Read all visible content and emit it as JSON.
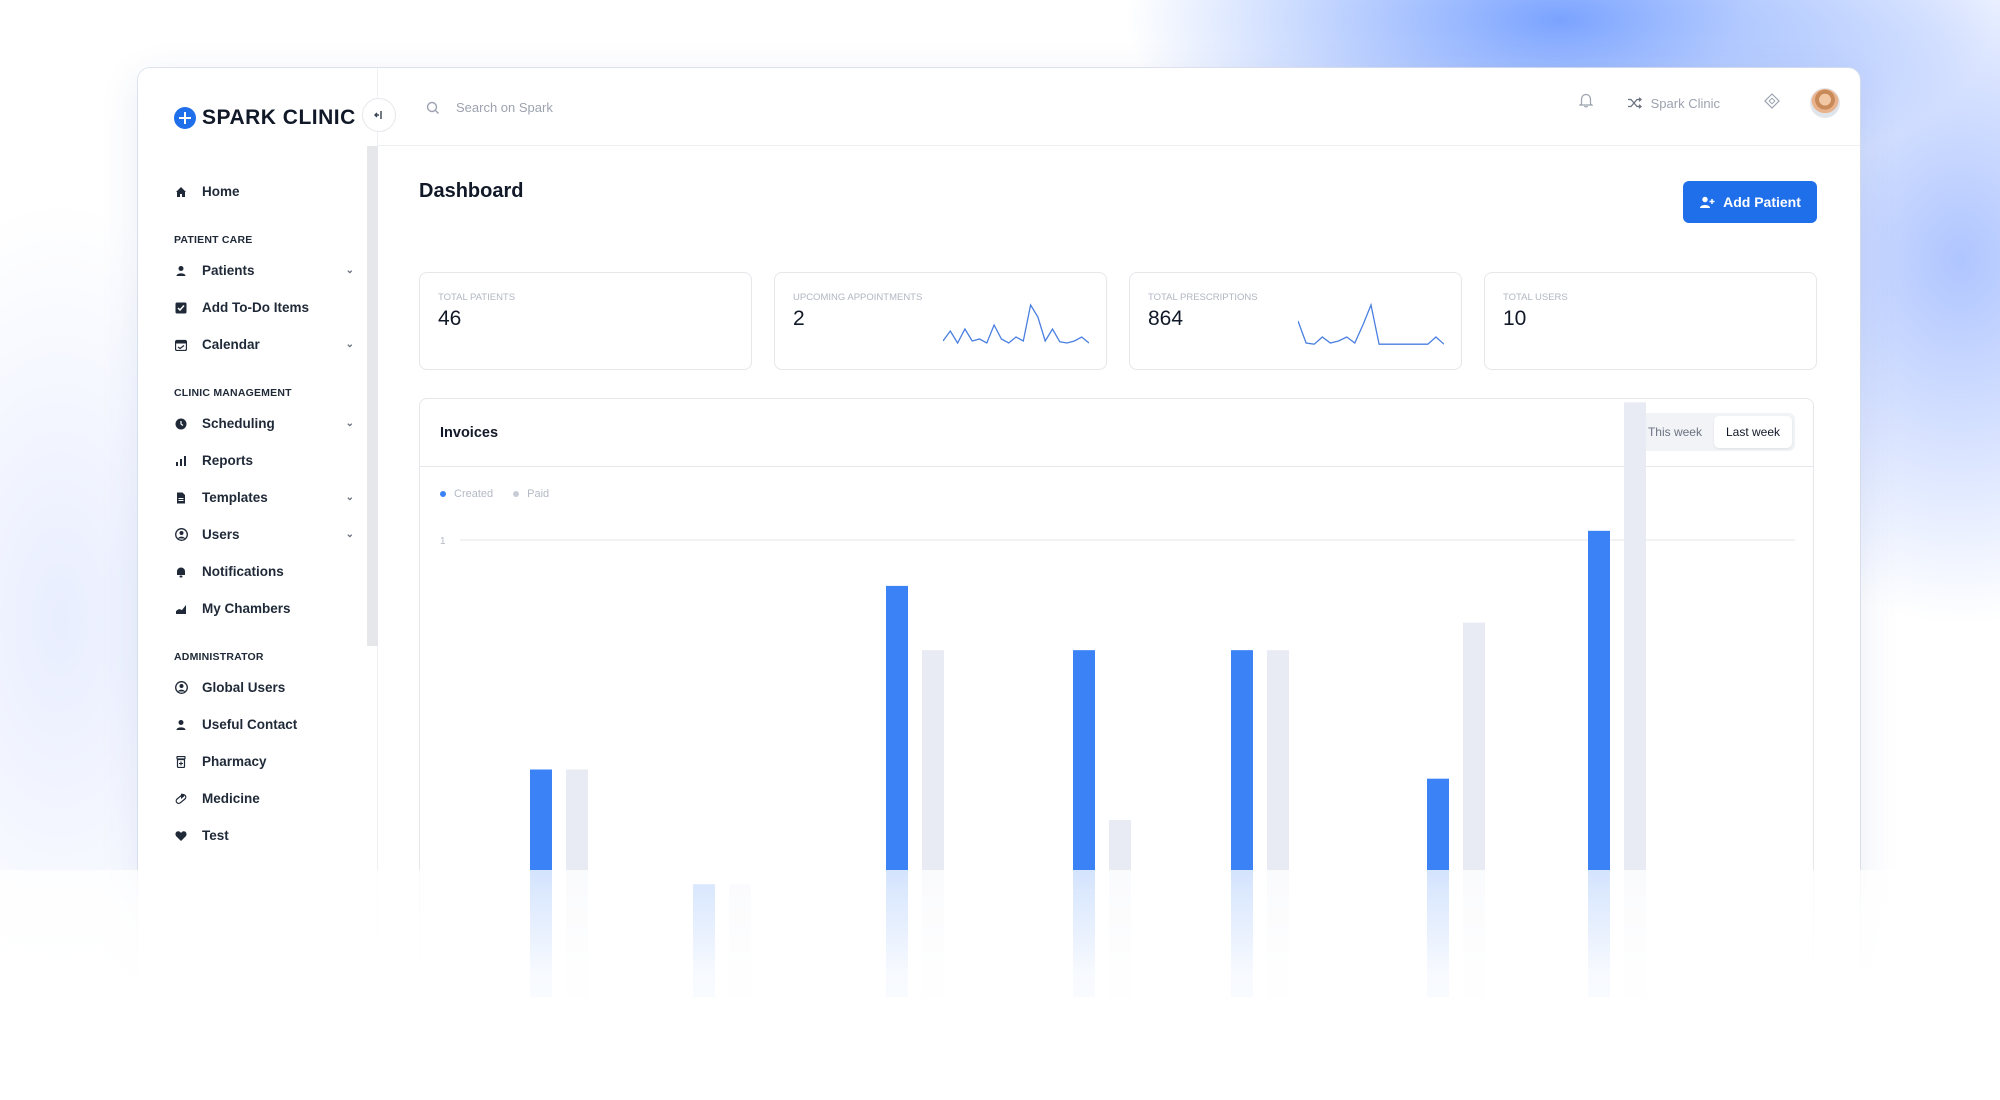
{
  "brand": {
    "name": "SPARK CLINIC"
  },
  "search": {
    "placeholder": "Search on Spark"
  },
  "header": {
    "workspace_label": "Spark Clinic"
  },
  "nav": {
    "home": "Home",
    "patient_care": {
      "title": "PATIENT CARE",
      "items": [
        "Patients",
        "Add To-Do Items",
        "Calendar"
      ]
    },
    "clinic_management": {
      "title": "CLINIC MANAGEMENT",
      "items": [
        "Scheduling",
        "Reports",
        "Templates",
        "Users",
        "Notifications",
        "My Chambers"
      ]
    },
    "administrator": {
      "title": "ADMINISTRATOR",
      "items": [
        "Global Users",
        "Useful Contact",
        "Pharmacy",
        "Medicine",
        "Test"
      ]
    }
  },
  "page": {
    "title": "Dashboard",
    "add_button": "Add Patient"
  },
  "stats": [
    {
      "label": "TOTAL PATIENTS",
      "value": "46"
    },
    {
      "label": "UPCOMING APPOINTMENTS",
      "value": "2"
    },
    {
      "label": "TOTAL PRESCRIPTIONS",
      "value": "864"
    },
    {
      "label": "TOTAL USERS",
      "value": "10"
    }
  ],
  "invoices": {
    "title": "Invoices",
    "toggle": {
      "this_week": "This week",
      "last_week": "Last week",
      "active": "last_week"
    }
  },
  "colors": {
    "accent": "#1f6feb",
    "bar_created": "#3b82f6",
    "bar_paid": "#e8ebf3"
  },
  "chart_data": {
    "type": "bar",
    "legend": [
      "Created",
      "Paid"
    ],
    "ytick": "1",
    "ylim": [
      0,
      1
    ],
    "series": [
      {
        "name": "Created",
        "values": [
          0.5,
          0.25,
          0.9,
          0.76,
          0.76,
          0.48,
          1.02
        ]
      },
      {
        "name": "Paid",
        "values": [
          0.5,
          0.25,
          0.76,
          0.39,
          0.76,
          0.82,
          1.3
        ]
      }
    ],
    "sparklines": {
      "upcoming_appointments": [
        0.1,
        0.35,
        0.05,
        0.4,
        0.1,
        0.15,
        0.05,
        0.5,
        0.15,
        0.05,
        0.2,
        0.1,
        1.0,
        0.7,
        0.1,
        0.4,
        0.08,
        0.05,
        0.1,
        0.2,
        0.05
      ],
      "total_prescriptions": [
        0.6,
        0.05,
        0.02,
        0.2,
        0.05,
        0.1,
        0.2,
        0.05,
        0.5,
        1.0,
        0.02,
        0.02,
        0.02,
        0.02,
        0.02,
        0.02,
        0.02,
        0.2,
        0.02
      ]
    }
  }
}
